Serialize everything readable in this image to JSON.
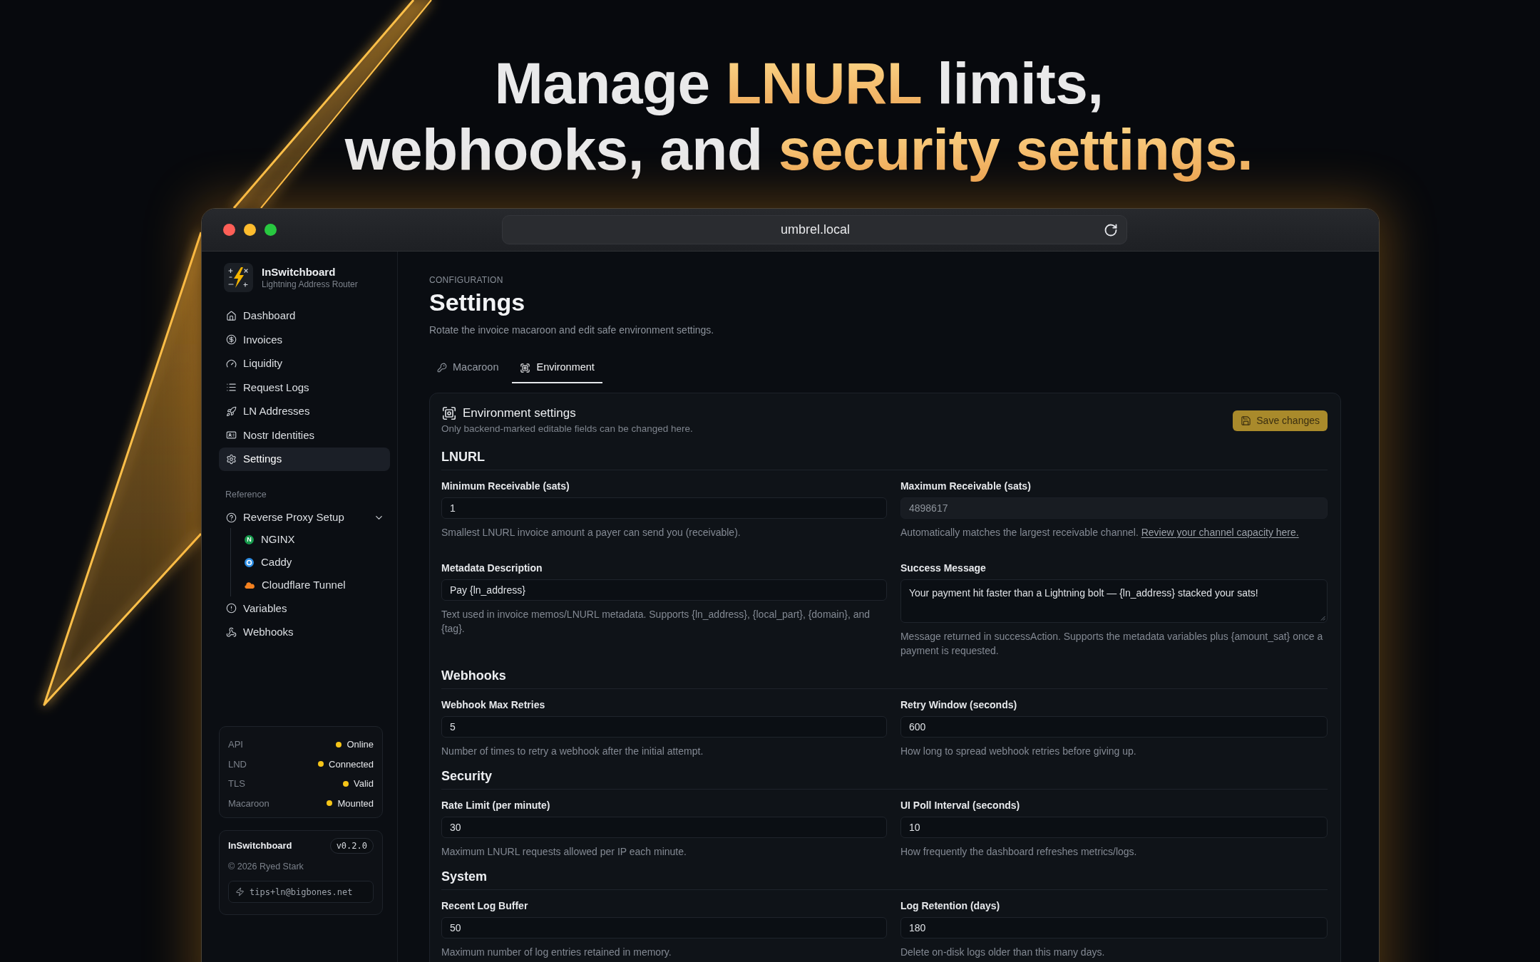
{
  "headline": {
    "lines": [
      [
        {
          "text": "Manage",
          "highlight": false
        },
        {
          "text": "LNURL",
          "highlight": true
        },
        {
          "text": "limits,",
          "highlight": false
        }
      ],
      [
        {
          "text": "webhooks, and",
          "highlight": false
        },
        {
          "text": "security settings.",
          "highlight": true
        }
      ]
    ]
  },
  "browser": {
    "url": "umbrel.local"
  },
  "sidebar": {
    "app": {
      "name": "InSwitchboard",
      "subtitle": "Lightning Address Router"
    },
    "nav": [
      {
        "label": "Dashboard",
        "selected": false
      },
      {
        "label": "Invoices",
        "selected": false
      },
      {
        "label": "Liquidity",
        "selected": false
      },
      {
        "label": "Request Logs",
        "selected": false
      },
      {
        "label": "LN Addresses",
        "selected": false
      },
      {
        "label": "Nostr Identities",
        "selected": false
      },
      {
        "label": "Settings",
        "selected": true
      }
    ],
    "reference": {
      "heading": "Reference",
      "items": [
        {
          "label": "Reverse Proxy Setup",
          "selected": false,
          "expanded": true,
          "children": [
            {
              "label": "NGINX",
              "mark": "N",
              "selected": false
            },
            {
              "label": "Caddy",
              "selected": false
            },
            {
              "label": "Cloudflare Tunnel",
              "selected": false
            }
          ]
        },
        {
          "label": "Variables",
          "selected": false
        },
        {
          "label": "Webhooks",
          "selected": false
        }
      ]
    },
    "status": [
      {
        "label": "API",
        "value": "Online",
        "color": "#f5c518"
      },
      {
        "label": "LND",
        "value": "Connected",
        "color": "#f5c518"
      },
      {
        "label": "TLS",
        "value": "Valid",
        "color": "#f5c518"
      },
      {
        "label": "Macaroon",
        "value": "Mounted",
        "color": "#f5c518"
      }
    ],
    "about": {
      "name": "InSwitchboard",
      "version": "v0.2.0",
      "copyright": "© 2026 Ryed Stark",
      "tip_address": "tips+ln@bigbones.net"
    }
  },
  "page": {
    "eyebrow": "CONFIGURATION",
    "title": "Settings",
    "subtitle": "Rotate the invoice macaroon and edit safe environment settings."
  },
  "tabs": [
    {
      "label": "Macaroon",
      "selected": false
    },
    {
      "label": "Environment",
      "selected": true
    }
  ],
  "panel": {
    "title": "Environment settings",
    "subtitle": "Only backend-marked editable fields can be changed here.",
    "save_button": {
      "label": "Save changes",
      "disabled": true
    },
    "sections": [
      {
        "title": "LNURL",
        "fields": [
          {
            "label": "Minimum Receivable (sats)",
            "kind": "input",
            "value": "1",
            "disabled": false,
            "help": "Smallest LNURL invoice amount a payer can send you (receivable)."
          },
          {
            "label": "Maximum Receivable (sats)",
            "kind": "input",
            "value": "4898617",
            "disabled": true,
            "help": "Automatically matches the largest receivable channel.",
            "help_link": "Review your channel capacity here."
          },
          {
            "label": "Metadata Description",
            "kind": "input",
            "value": "Pay {ln_address}",
            "disabled": false,
            "help": "Text used in invoice memos/LNURL metadata. Supports {ln_address}, {local_part}, {domain}, and {tag}."
          },
          {
            "label": "Success Message",
            "kind": "textarea",
            "value": "Your payment hit faster than a Lightning bolt — {ln_address} stacked your sats!",
            "disabled": false,
            "help": "Message returned in successAction. Supports the metadata variables plus {amount_sat} once a payment is requested."
          }
        ]
      },
      {
        "title": "Webhooks",
        "fields": [
          {
            "label": "Webhook Max Retries",
            "kind": "input",
            "value": "5",
            "disabled": false,
            "help": "Number of times to retry a webhook after the initial attempt."
          },
          {
            "label": "Retry Window (seconds)",
            "kind": "input",
            "value": "600",
            "disabled": false,
            "help": "How long to spread webhook retries before giving up."
          }
        ]
      },
      {
        "title": "Security",
        "fields": [
          {
            "label": "Rate Limit (per minute)",
            "kind": "input",
            "value": "30",
            "disabled": false,
            "help": "Maximum LNURL requests allowed per IP each minute."
          },
          {
            "label": "UI Poll Interval (seconds)",
            "kind": "input",
            "value": "10",
            "disabled": false,
            "help": "How frequently the dashboard refreshes metrics/logs."
          }
        ]
      },
      {
        "title": "System",
        "fields": [
          {
            "label": "Recent Log Buffer",
            "kind": "input",
            "value": "50",
            "disabled": false,
            "help": "Maximum number of log entries retained in memory."
          },
          {
            "label": "Log Retention (days)",
            "kind": "input",
            "value": "180",
            "disabled": false,
            "help": "Delete on-disk logs older than this many days."
          }
        ]
      }
    ]
  }
}
